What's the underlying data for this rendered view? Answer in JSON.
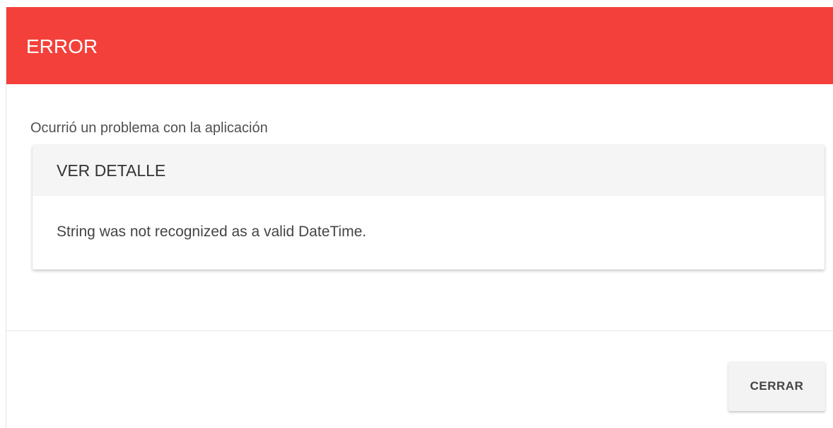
{
  "dialog": {
    "title": "ERROR",
    "message": "Ocurrió un problema con la aplicación",
    "detail": {
      "header_label": "VER DETALLE",
      "body_text": "String was not recognized as a valid DateTime."
    },
    "close_label": "CERRAR"
  },
  "colors": {
    "header_background": "#f4403a",
    "header_text": "#ffffff"
  }
}
